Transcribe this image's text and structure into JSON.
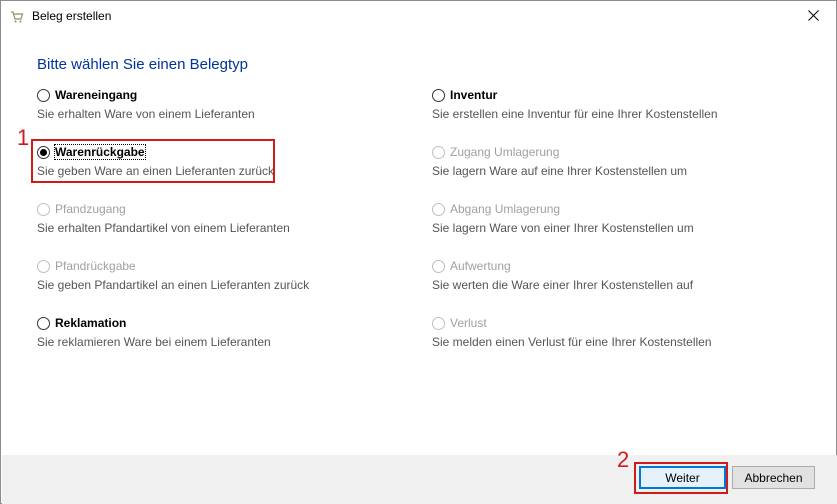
{
  "window": {
    "title": "Beleg erstellen",
    "app_icon": "cart-icon",
    "close_icon": "close-icon"
  },
  "heading": "Bitte wählen Sie einen Belegtyp",
  "options_left": [
    {
      "label": "Wareneingang",
      "desc": "Sie erhalten Ware von einem Lieferanten",
      "enabled": true,
      "checked": false
    },
    {
      "label": "Warenrückgabe",
      "desc": "Sie geben Ware an einen Lieferanten zurück",
      "enabled": true,
      "checked": true
    },
    {
      "label": "Pfandzugang",
      "desc": "Sie erhalten Pfandartikel von einem Lieferanten",
      "enabled": false,
      "checked": false
    },
    {
      "label": "Pfandrückgabe",
      "desc": "Sie geben Pfandartikel an einen Lieferanten zurück",
      "enabled": false,
      "checked": false
    },
    {
      "label": "Reklamation",
      "desc": "Sie reklamieren Ware bei einem Lieferanten",
      "enabled": true,
      "checked": false
    }
  ],
  "options_right": [
    {
      "label": "Inventur",
      "desc": "Sie erstellen eine Inventur für eine Ihrer Kostenstellen",
      "enabled": true,
      "checked": false
    },
    {
      "label": "Zugang Umlagerung",
      "desc": "Sie lagern Ware auf eine Ihrer Kostenstellen um",
      "enabled": false,
      "checked": false
    },
    {
      "label": "Abgang Umlagerung",
      "desc": "Sie lagern Ware von einer Ihrer Kostenstellen um",
      "enabled": false,
      "checked": false
    },
    {
      "label": "Aufwertung",
      "desc": "Sie werten die Ware einer Ihrer Kostenstellen auf",
      "enabled": false,
      "checked": false
    },
    {
      "label": "Verlust",
      "desc": "Sie melden einen Verlust für eine Ihrer Kostenstellen",
      "enabled": false,
      "checked": false
    }
  ],
  "annotations": {
    "marker1": "1",
    "marker2": "2",
    "color": "#d11a1a"
  },
  "buttons": {
    "next": "Weiter",
    "cancel": "Abbrechen"
  }
}
